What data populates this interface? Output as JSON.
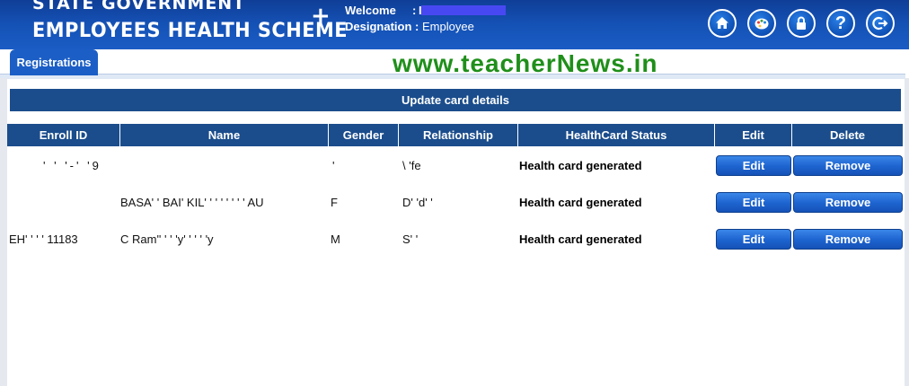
{
  "header": {
    "brand_line1": "STATE GOVERNMENT",
    "brand_line2": "EMPLOYEES HEALTH SCHEME",
    "brand_plus": "+",
    "welcome_label": "Welcome",
    "welcome_colon": ":",
    "welcome_value": "I",
    "designation_label": "Designation",
    "designation_colon": ":",
    "designation_value": "Employee",
    "icons": [
      "home-icon",
      "palette-icon",
      "lock-icon",
      "help-icon",
      "logout-icon"
    ],
    "icon_glyphs": {
      "help": "?"
    }
  },
  "tabs": [
    {
      "label": "Registrations",
      "active": true
    }
  ],
  "watermark": "www.teacherNews.in",
  "panel": {
    "title": "Update card details"
  },
  "table": {
    "columns": [
      "Enroll ID",
      "Name",
      "Gender",
      "Relationship",
      "HealthCard Status",
      "Edit",
      "Delete"
    ],
    "rows": [
      {
        "enroll_id": "' ' '-' '9",
        "name": "",
        "gender": "'",
        "relationship": "\\ 'fe",
        "status": "Health card generated",
        "edit_label": "Edit",
        "remove_label": "Remove"
      },
      {
        "enroll_id": "",
        "name": "BASA' ' BAI' KIL' ' ' ' ' ' ' ' AU",
        "gender": "F",
        "relationship": "D' 'd' '",
        "status": "Health card generated",
        "edit_label": "Edit",
        "remove_label": "Remove"
      },
      {
        "enroll_id": "EH' ' ' ' 11183",
        "name": "C Ram'' ' ' 'y' ' ' ' 'y",
        "gender": "M",
        "relationship": "S' '",
        "status": "Health card generated",
        "edit_label": "Edit",
        "remove_label": "Remove"
      }
    ]
  },
  "colors": {
    "header_blue": "#1552b6",
    "table_header": "#1b4d8c",
    "button_blue": "#1d63cf",
    "watermark_green": "#1f8f1a"
  }
}
